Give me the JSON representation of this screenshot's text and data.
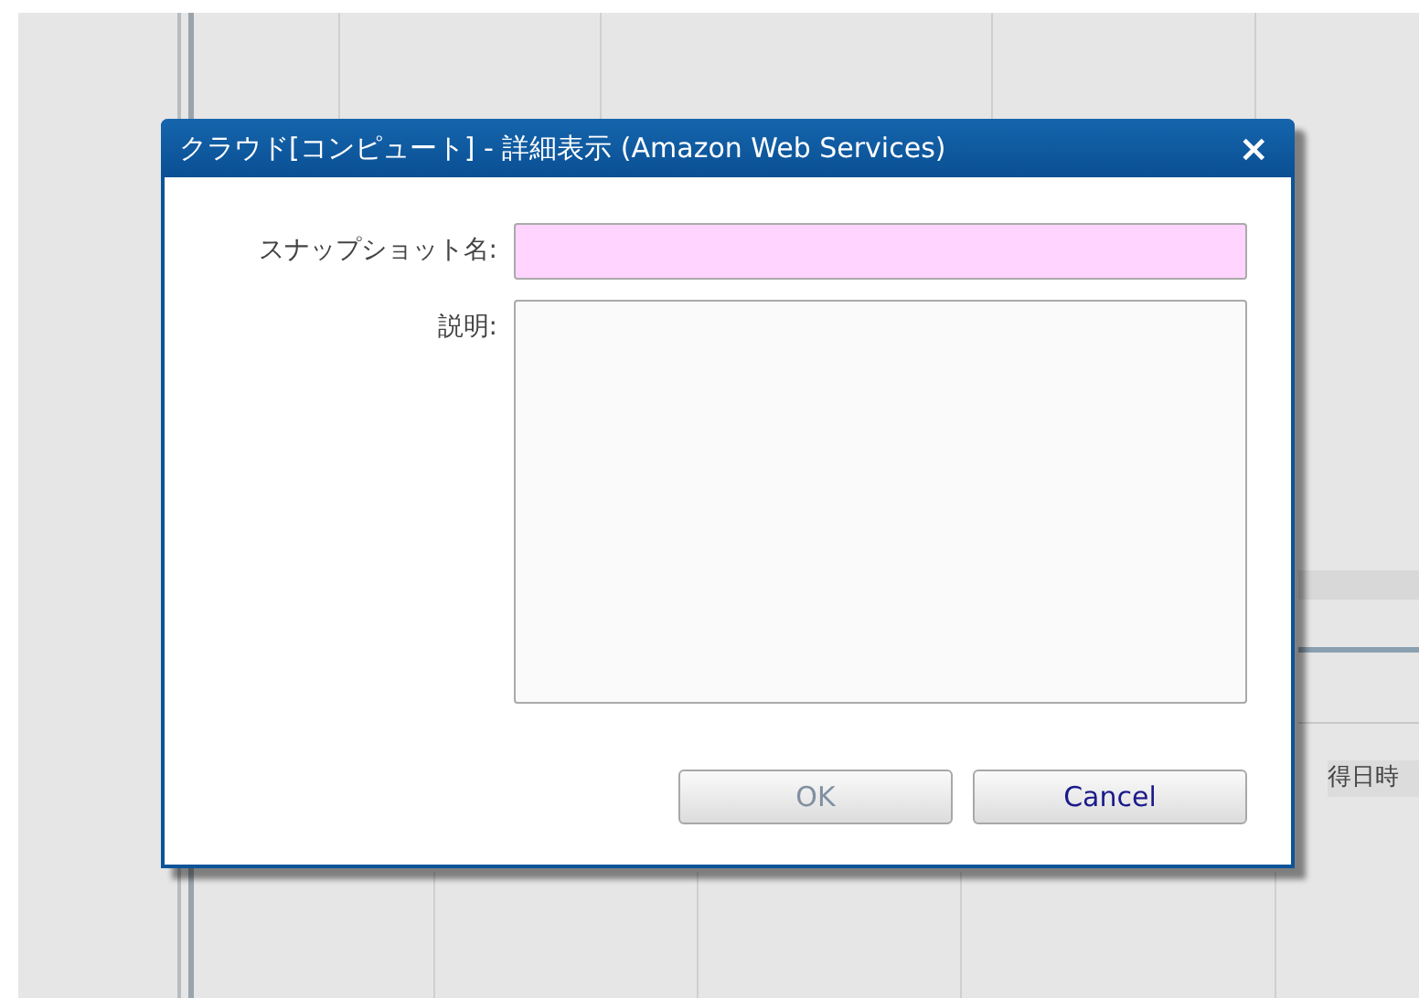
{
  "background": {
    "column_header_fragment": "得日時"
  },
  "dialog": {
    "title": "クラウド[コンピュート] - 詳細表示 (Amazon Web Services)",
    "close_label": "×",
    "fields": [
      {
        "kind": "text",
        "label": "スナップショット名:",
        "required": true
      },
      {
        "kind": "textarea",
        "label": "説明:",
        "required": false
      }
    ],
    "buttons": [
      {
        "label": "OK",
        "disabled": true
      },
      {
        "label": "Cancel",
        "disabled": false
      }
    ]
  }
}
